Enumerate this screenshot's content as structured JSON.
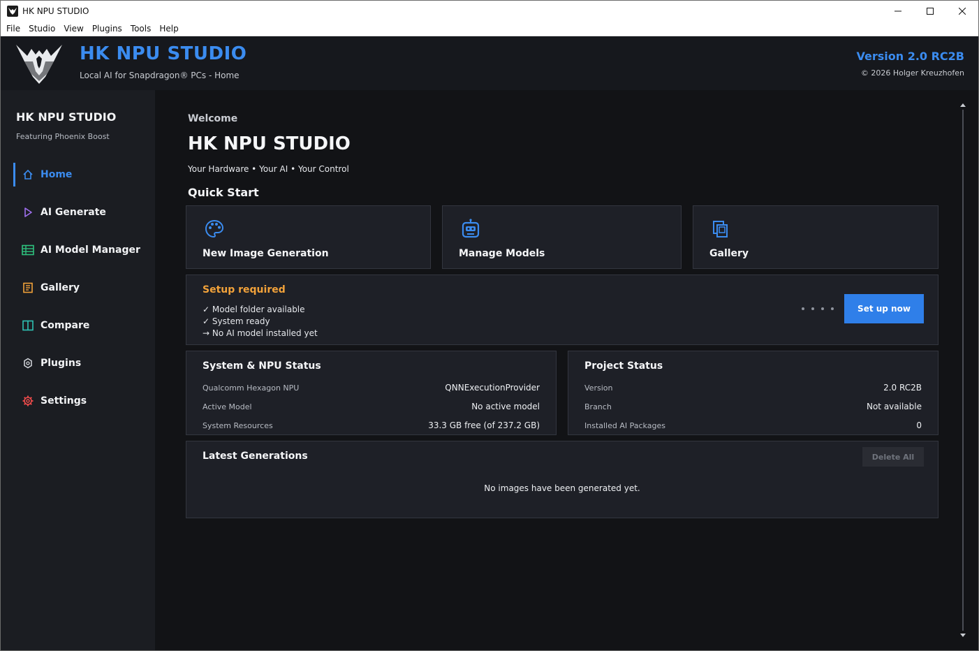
{
  "window": {
    "title": "HK NPU STUDIO",
    "controls": {
      "minimize": "—",
      "maximize": "☐",
      "close": "✕"
    }
  },
  "menu": [
    "File",
    "Studio",
    "View",
    "Plugins",
    "Tools",
    "Help"
  ],
  "header": {
    "title": "HK NPU STUDIO",
    "subtitle": "Local AI for Snapdragon® PCs - Home",
    "version": "Version 2.0 RC2B",
    "copyright": "© 2026 Holger Kreuzhofen"
  },
  "sidebar": {
    "title": "HK NPU STUDIO",
    "subtitle": "Featuring Phoenix Boost",
    "items": [
      {
        "label": "Home",
        "icon": "home-icon",
        "color": "#3b8cf0",
        "active": true
      },
      {
        "label": "AI Generate",
        "icon": "play-icon",
        "color": "#a070f0"
      },
      {
        "label": "AI Model Manager",
        "icon": "table-icon",
        "color": "#2ec27e"
      },
      {
        "label": "Gallery",
        "icon": "gallery-icon",
        "color": "#f2a23a"
      },
      {
        "label": "Compare",
        "icon": "compare-icon",
        "color": "#2ec2b4"
      },
      {
        "label": "Plugins",
        "icon": "plugin-icon",
        "color": "#d7dae0"
      },
      {
        "label": "Settings",
        "icon": "gear-icon",
        "color": "#ef4b4b"
      }
    ]
  },
  "main": {
    "welcome": "Welcome",
    "title": "HK NPU STUDIO",
    "tagline": "Your Hardware • Your AI • Your Control",
    "quick_start_title": "Quick Start",
    "quick_start": [
      {
        "label": "New Image Generation",
        "icon": "palette-icon"
      },
      {
        "label": "Manage Models",
        "icon": "robot-icon"
      },
      {
        "label": "Gallery",
        "icon": "images-icon"
      }
    ],
    "setup": {
      "title": "Setup required",
      "lines": [
        "✓ Model folder available",
        "✓ System ready",
        "→ No AI model installed yet"
      ],
      "button": "Set up now"
    },
    "system_status": {
      "title": "System & NPU Status",
      "rows": [
        {
          "key": "Qualcomm Hexagon NPU",
          "value": "QNNExecutionProvider"
        },
        {
          "key": "Active Model",
          "value": "No active model"
        },
        {
          "key": "System Resources",
          "value": "33.3 GB free (of 237.2 GB)"
        }
      ]
    },
    "project_status": {
      "title": "Project Status",
      "rows": [
        {
          "key": "Version",
          "value": "2.0 RC2B"
        },
        {
          "key": "Branch",
          "value": "Not available"
        },
        {
          "key": "Installed AI Packages",
          "value": "0"
        }
      ]
    },
    "latest": {
      "title": "Latest Generations",
      "delete_button": "Delete All",
      "empty_message": "No images have been generated yet."
    }
  },
  "colors": {
    "accent": "#3b8cf0",
    "warning": "#f2a23a",
    "button_primary": "#2f7fe9"
  }
}
